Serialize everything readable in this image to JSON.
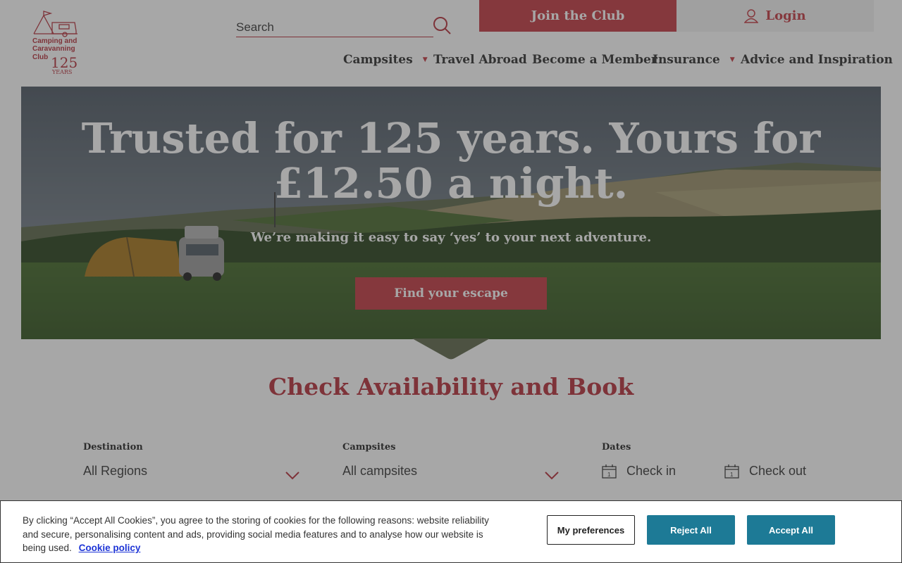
{
  "brand": {
    "logo_text_line1": "Camping and",
    "logo_text_line2": "Caravanning",
    "logo_text_line3": "Club",
    "logo_number": "125",
    "logo_years": "YEARS",
    "color": "#b52d38"
  },
  "search": {
    "placeholder": "Search"
  },
  "header": {
    "join_label": "Join the Club",
    "login_label": "Login"
  },
  "nav": {
    "items": [
      {
        "label": "Campsites",
        "has_dropdown": true
      },
      {
        "label": "Travel Abroad",
        "has_dropdown": false
      },
      {
        "label": "Become a Member",
        "has_dropdown": false
      },
      {
        "label": "Insurance",
        "has_dropdown": true
      },
      {
        "label": "Advice and Inspiration",
        "has_dropdown": false
      }
    ],
    "caret": "▼"
  },
  "hero": {
    "title": "Trusted for 125 years. Yours for £12.50 a night.",
    "subtitle": "We’re making it easy to say ‘yes’ to your next adventure.",
    "button_label": "Find your escape"
  },
  "availability": {
    "title": "Check Availability and Book",
    "destination_label": "Destination",
    "destination_value": "All Regions",
    "campsites_label": "Campsites",
    "campsites_value": "All campsites",
    "dates_label": "Dates",
    "check_in": "Check in",
    "check_out": "Check out",
    "calendar_day": "1"
  },
  "cookie_banner": {
    "text": "By clicking “Accept All Cookies”, you agree to the storing of cookies for the following reasons: website reliability and secure, personalising content and ads, providing social media features and to analyse how our website is being used.",
    "link_label": "Cookie policy",
    "preferences_label": "My preferences",
    "reject_label": "Reject All",
    "accept_label": "Accept All"
  },
  "colors": {
    "accent": "#c2363f",
    "cookie_button": "#1d7a96",
    "link": "#1d34d6"
  }
}
